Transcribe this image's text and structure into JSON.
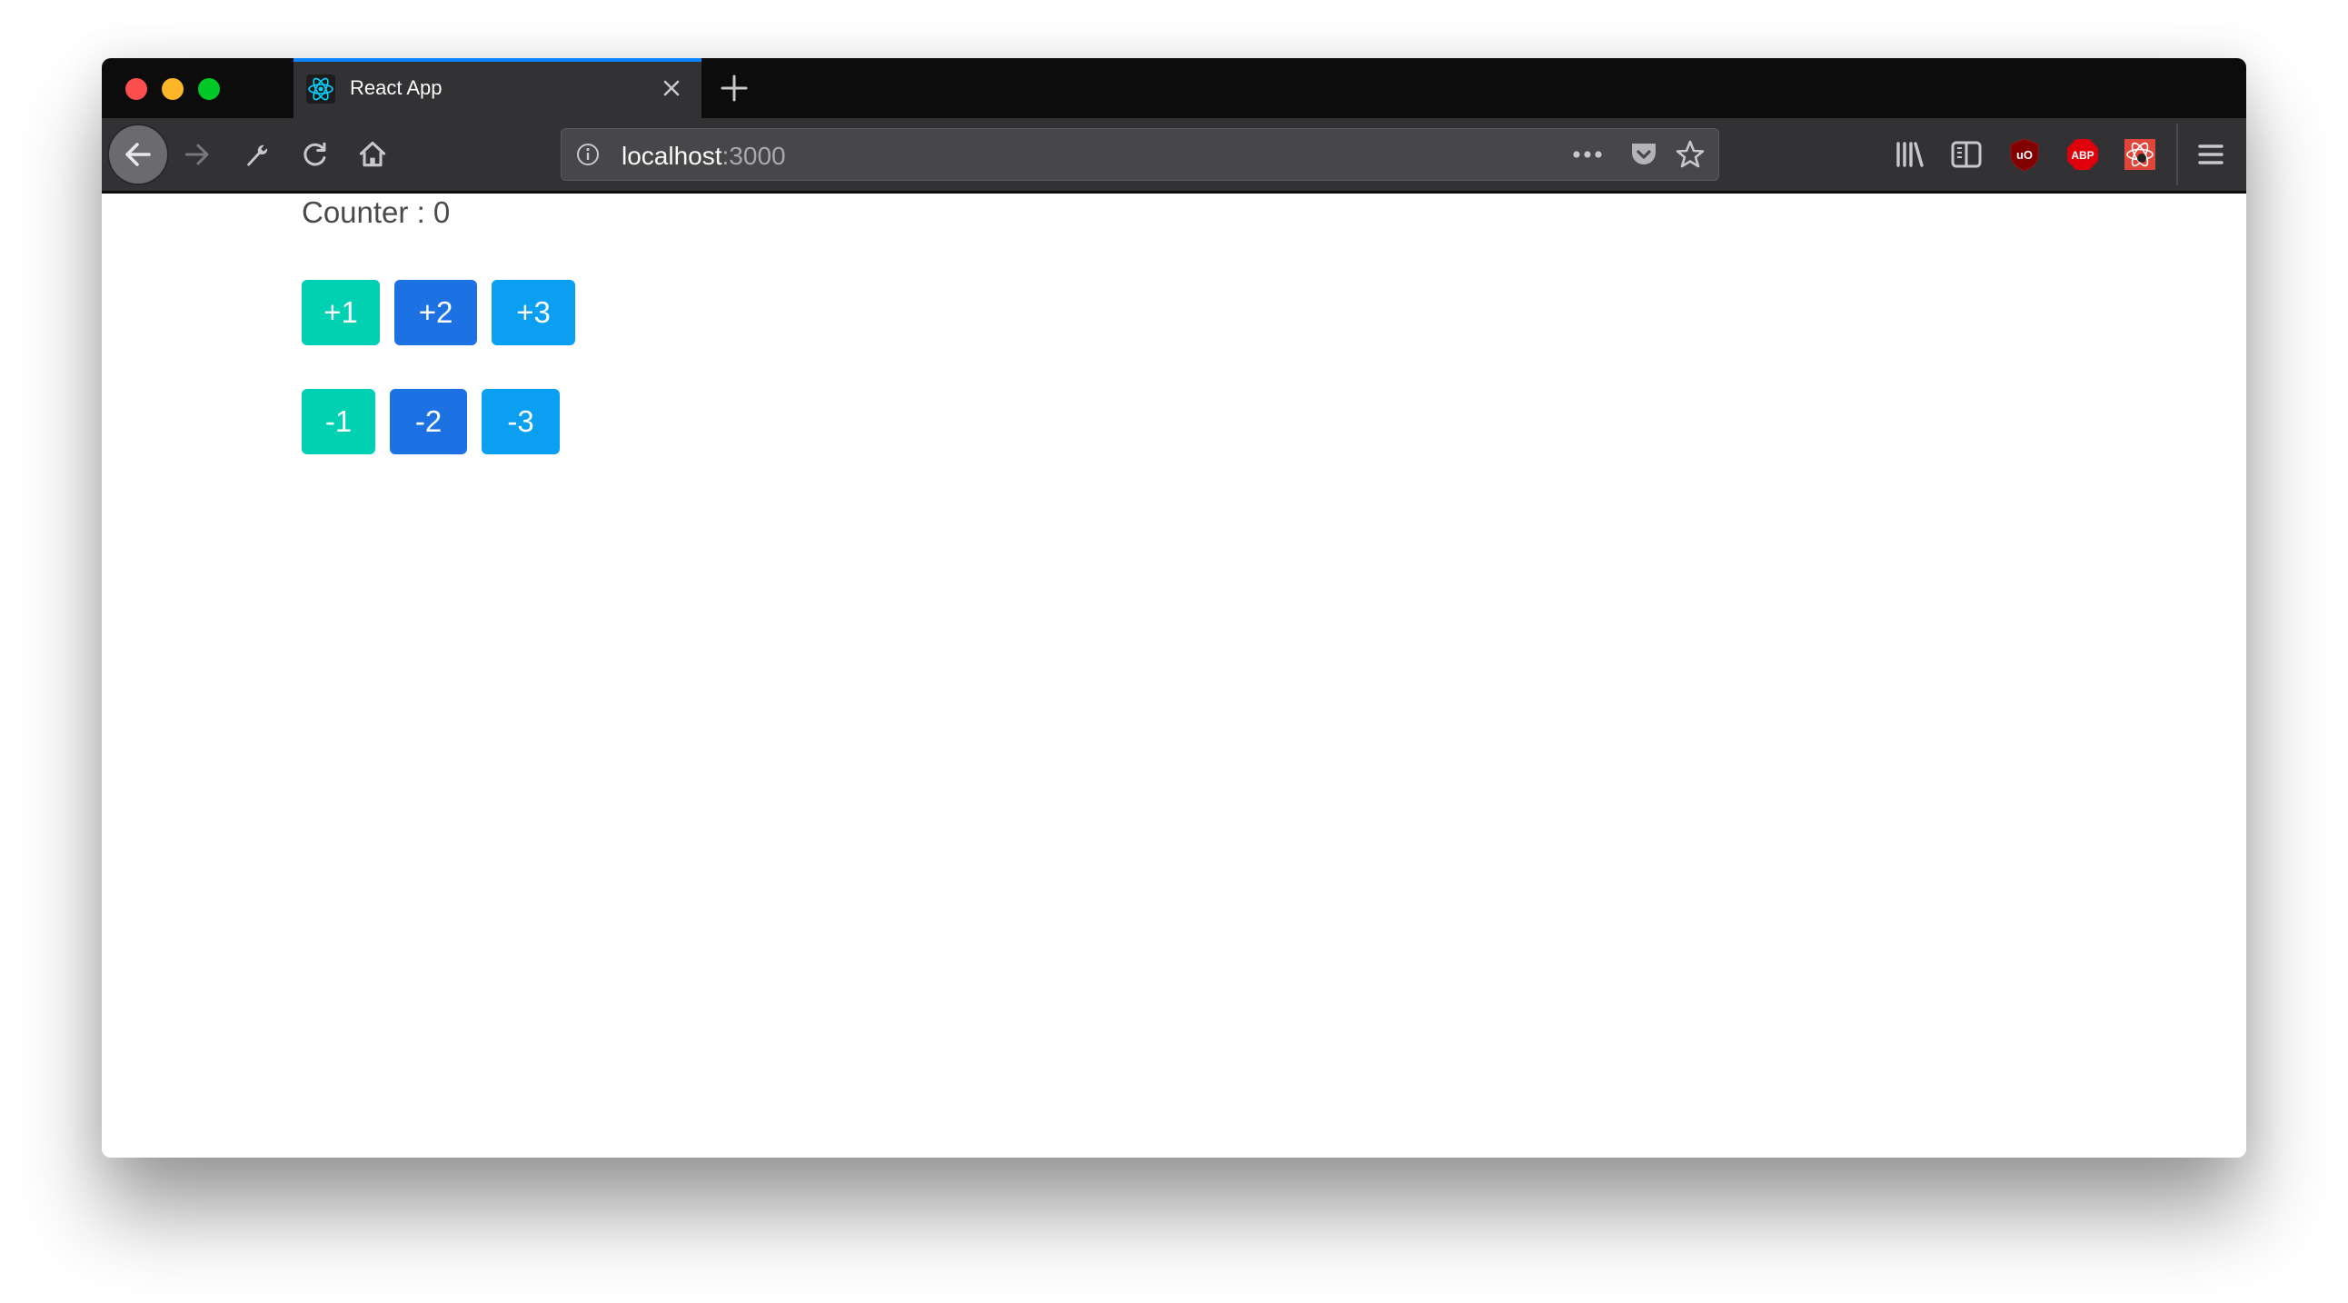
{
  "browser": {
    "tab": {
      "title": "React App",
      "favicon": "react-logo-icon"
    },
    "url": {
      "host": "localhost",
      "port": ":3000"
    },
    "toolbar_icons": [
      "back-icon",
      "forward-icon",
      "wrench-icon",
      "reload-icon",
      "home-icon"
    ],
    "urlbar_icons": [
      "info-icon",
      "more-icon",
      "pocket-icon",
      "star-icon"
    ],
    "extension_icons": [
      "library-icon",
      "sidebar-icon",
      "ublock-origin-icon",
      "adblock-plus-icon",
      "react-devtools-icon",
      "menu-icon"
    ],
    "abp_label": "ABP",
    "ublock_label": "uO"
  },
  "page": {
    "counter_label": "Counter : 0",
    "increment_buttons": [
      {
        "label": "+1",
        "color": "#00d1b2"
      },
      {
        "label": "+2",
        "color": "#1d72e3"
      },
      {
        "label": "+3",
        "color": "#0a9ff0"
      }
    ],
    "decrement_buttons": [
      {
        "label": "-1",
        "color": "#00d1b2"
      },
      {
        "label": "-2",
        "color": "#1d72e3"
      },
      {
        "label": "-3",
        "color": "#0a9ff0"
      }
    ]
  },
  "colors": {
    "tab_accent": "#0a84ff",
    "toolbar_bg": "#323234",
    "tabbar_bg": "#0c0c0d"
  }
}
